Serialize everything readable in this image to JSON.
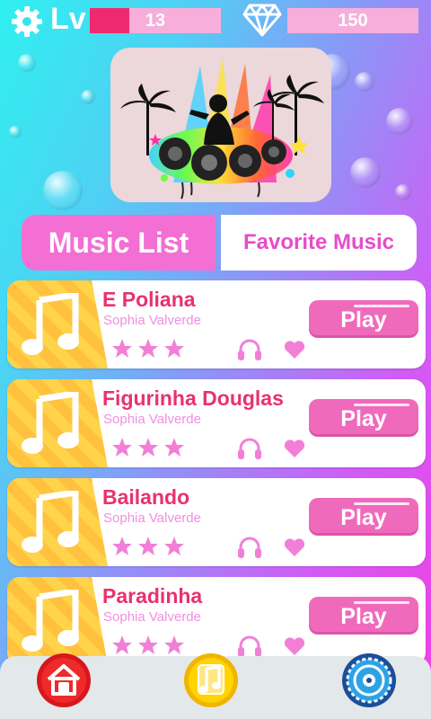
{
  "topbar": {
    "level_label": "Lv",
    "level_value": "13",
    "level_progress": 0.3,
    "gems_value": "150",
    "icons": {
      "settings": "gear-icon",
      "gems": "diamond-icon"
    }
  },
  "artwork": {
    "icon": "dj-party-artwork"
  },
  "tabs": {
    "music_list": "Music List",
    "favorite_music": "Favorite Music",
    "active": "music_list"
  },
  "songs": [
    {
      "title": "E Poliana",
      "artist": "Sophia Valverde",
      "stars": 3,
      "play_label": "Play"
    },
    {
      "title": "Figurinha Douglas",
      "artist": "Sophia Valverde",
      "stars": 3,
      "play_label": "Play"
    },
    {
      "title": "Bailando",
      "artist": "Sophia Valverde",
      "stars": 3,
      "play_label": "Play"
    },
    {
      "title": "Paradinha",
      "artist": "Sophia Valverde",
      "stars": 3,
      "play_label": "Play"
    }
  ],
  "nav": {
    "home": "home-icon",
    "music": "music-note-icon",
    "disc": "vinyl-disc-icon"
  },
  "colors": {
    "pink": "#f06abc",
    "title": "#e8326f",
    "gold": "#ffd34a",
    "navy": "#1b4e9a"
  }
}
